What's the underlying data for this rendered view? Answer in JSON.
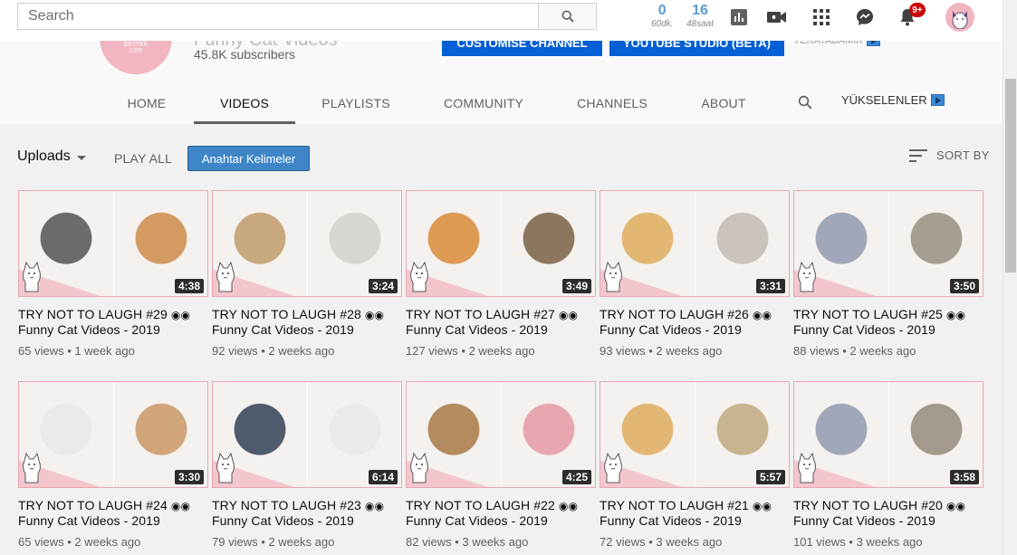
{
  "search": {
    "placeholder": "Search"
  },
  "stats": [
    {
      "num": "0",
      "label": "60dk."
    },
    {
      "num": "16",
      "label": "48saat"
    }
  ],
  "notifications": {
    "badge": "9+"
  },
  "channel": {
    "name": "Funny Cat Videos",
    "subscribers": "45.8K subscribers",
    "avatar_text": "LIVE A BETTER LIFE",
    "customise_label": "CUSTOMISE CHANNEL",
    "studio_label": "YOUTUBE STUDIO (BETA)",
    "yk_label": "YERATABAMIK"
  },
  "tabs": [
    {
      "label": "HOME"
    },
    {
      "label": "VIDEOS"
    },
    {
      "label": "PLAYLISTS"
    },
    {
      "label": "COMMUNITY"
    },
    {
      "label": "CHANNELS"
    },
    {
      "label": "ABOUT"
    }
  ],
  "yukselenler": "YÜKSELENLER",
  "toolbar": {
    "uploads": "Uploads",
    "play_all": "PLAY ALL",
    "anahtar": "Anahtar Kelimeler",
    "sort_by": "SORT BY"
  },
  "videos": [
    {
      "title1": "TRY NOT TO LAUGH #29",
      "title2": "Funny Cat Videos - 2019",
      "views": "65 views",
      "age": "1 week ago",
      "duration": "4:38",
      "colors": [
        "#6e6a68",
        "#d39b62"
      ]
    },
    {
      "title1": "TRY NOT TO LAUGH #28",
      "title2": "Funny Cat Videos - 2019",
      "views": "92 views",
      "age": "2 weeks ago",
      "duration": "3:24",
      "colors": [
        "#c8a97e",
        "#d9d6d2"
      ]
    },
    {
      "title1": "TRY NOT TO LAUGH #27",
      "title2": "Funny Cat Videos - 2019",
      "views": "127 views",
      "age": "2 weeks ago",
      "duration": "3:49",
      "colors": [
        "#dc9a52",
        "#8d7660"
      ]
    },
    {
      "title1": "TRY NOT TO LAUGH #26",
      "title2": "Funny Cat Videos - 2019",
      "views": "93 views",
      "age": "2 weeks ago",
      "duration": "3:31",
      "colors": [
        "#e2b774",
        "#c9c3bb"
      ]
    },
    {
      "title1": "TRY NOT TO LAUGH #25",
      "title2": "Funny Cat Videos - 2019",
      "views": "88 views",
      "age": "2 weeks ago",
      "duration": "3:50",
      "colors": [
        "#9fa7b8",
        "#a69e92"
      ]
    },
    {
      "title1": "TRY NOT TO LAUGH #24",
      "title2": "Funny Cat Videos - 2019",
      "views": "65 views",
      "age": "2 weeks ago",
      "duration": "3:30",
      "colors": [
        "#eceae8",
        "#d0a57a"
      ]
    },
    {
      "title1": "TRY NOT TO LAUGH #23",
      "title2": "Funny Cat Videos - 2019",
      "views": "79 views",
      "age": "2 weeks ago",
      "duration": "6:14",
      "colors": [
        "#4f5a6c",
        "#ece9e7"
      ]
    },
    {
      "title1": "TRY NOT TO LAUGH #22",
      "title2": "Funny Cat Videos - 2019",
      "views": "82 views",
      "age": "3 weeks ago",
      "duration": "4:25",
      "colors": [
        "#b48a5f",
        "#e7a6b0"
      ]
    },
    {
      "title1": "TRY NOT TO LAUGH #21",
      "title2": "Funny Cat Videos - 2019",
      "views": "72 views",
      "age": "3 weeks ago",
      "duration": "5:57",
      "colors": [
        "#e2b774",
        "#c7b490"
      ]
    },
    {
      "title1": "TRY NOT TO LAUGH #20",
      "title2": "Funny Cat Videos - 2019",
      "views": "101 views",
      "age": "3 weeks ago",
      "duration": "3:58",
      "colors": [
        "#9fa7b8",
        "#a39a8d"
      ]
    }
  ]
}
